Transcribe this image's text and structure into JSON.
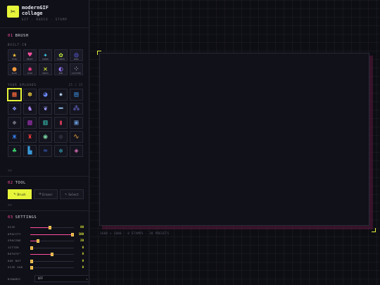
{
  "brand": {
    "logo_glyph": "✂",
    "name": "modernGIF",
    "sub": "collage",
    "nav": "GIF · RADIO · STAMP"
  },
  "brush": {
    "num": "01",
    "title": "BRUSH",
    "builtin_label": "BUILT-IN",
    "builtin": [
      {
        "icon": "star-icon",
        "glyph": "★",
        "color": "#f5c53a",
        "label": "STAR"
      },
      {
        "icon": "heart-icon",
        "glyph": "♥",
        "color": "#ff4fa0",
        "label": "HEART"
      },
      {
        "icon": "sparkle-icon",
        "glyph": "✦",
        "color": "#3ad9f5",
        "label": "SPARK"
      },
      {
        "icon": "flower-icon",
        "glyph": "✿",
        "color": "#c8f53a",
        "label": "FLOWER"
      },
      {
        "icon": "ring-icon",
        "glyph": "◎",
        "color": "#6a6aff",
        "label": "RING"
      },
      {
        "icon": "blob-icon",
        "glyph": "●",
        "color": "#f59a3a",
        "label": "BLOB"
      },
      {
        "icon": "glow-icon",
        "glyph": "✺",
        "color": "#ff3a8a",
        "label": "GLOW"
      },
      {
        "icon": "cross-icon",
        "glyph": "✕",
        "color": "#e6f53a",
        "label": "CROSS"
      },
      {
        "icon": "rainbow-orb-icon",
        "glyph": "◐",
        "color": "#9a7aff",
        "label": "ORB"
      },
      {
        "icon": "scatter-icon",
        "glyph": "⁘",
        "color": "#d0d0e0",
        "label": "SCATTER"
      }
    ],
    "uploads_label": "YOUR UPLOADS",
    "uploads_count": "25 / 25",
    "uploads": [
      {
        "icon": "rainbow-image-icon",
        "glyph": "▦",
        "color": "#ff6a3a"
      },
      {
        "icon": "flower-image-icon",
        "glyph": "✽",
        "color": "#e6c53a"
      },
      {
        "icon": "eyes-image-icon",
        "glyph": "◕",
        "color": "#6a8aff"
      },
      {
        "icon": "sparkle-image-icon",
        "glyph": "✷",
        "color": "#c0e0ff"
      },
      {
        "icon": "sky-image-icon",
        "glyph": "▤",
        "color": "#3a8ad9"
      },
      {
        "icon": "crystal-image-icon",
        "glyph": "❖",
        "color": "#8a9aff"
      },
      {
        "icon": "figure-image-icon",
        "glyph": "♞",
        "color": "#b08aff"
      },
      {
        "icon": "bird-image-icon",
        "glyph": "❦",
        "color": "#a0a0ff"
      },
      {
        "icon": "laser-image-icon",
        "glyph": "━",
        "color": "#9ad0ff"
      },
      {
        "icon": "stars-image-icon",
        "glyph": "⁂",
        "color": "#6a6ad0"
      },
      {
        "icon": "rock-image-icon",
        "glyph": "◆",
        "color": "#6a6a7a"
      },
      {
        "icon": "neon-image-icon",
        "glyph": "▧",
        "color": "#c03ad9"
      },
      {
        "icon": "rain-image-icon",
        "glyph": "▥",
        "color": "#3ad0c0"
      },
      {
        "icon": "drink-image-icon",
        "glyph": "▮",
        "color": "#d03a5a"
      },
      {
        "icon": "window-image-icon",
        "glyph": "▣",
        "color": "#6a9ad9"
      },
      {
        "icon": "butterfly-image-icon",
        "glyph": "ж",
        "color": "#3a8aff"
      },
      {
        "icon": "robot-image-icon",
        "glyph": "♜",
        "color": "#e63a3a"
      },
      {
        "icon": "disc-image-icon",
        "glyph": "◉",
        "color": "#7ad0a0"
      },
      {
        "icon": "planet-image-icon",
        "glyph": "●",
        "color": "#2a2a3a"
      },
      {
        "icon": "wave-image-icon",
        "glyph": "∿",
        "color": "#e6a23a"
      },
      {
        "icon": "cactus-image-icon",
        "glyph": "♣",
        "color": "#3ad06a"
      },
      {
        "icon": "city-image-icon",
        "glyph": "▙",
        "color": "#3a9ad9"
      },
      {
        "icon": "ocean-image-icon",
        "glyph": "≈",
        "color": "#3a6ad9"
      },
      {
        "icon": "feather-image-icon",
        "glyph": "✲",
        "color": "#3ac0d9"
      },
      {
        "icon": "gem-image-icon",
        "glyph": "◈",
        "color": "#d06ab0"
      }
    ],
    "collapse": ">>"
  },
  "tool": {
    "num": "02",
    "title": "TOOL",
    "items": [
      {
        "icon": "pencil-icon",
        "glyph": "✎",
        "label": "Brush",
        "active": true
      },
      {
        "icon": "eraser-icon",
        "glyph": "⌫",
        "label": "Eraser",
        "active": false
      },
      {
        "icon": "cursor-icon",
        "glyph": "↖",
        "label": "Select",
        "active": false
      }
    ],
    "collapse": ">>"
  },
  "settings": {
    "num": "03",
    "title": "SETTINGS",
    "rows": [
      {
        "label": "SIZE",
        "value": "80",
        "level": 0.45
      },
      {
        "label": "OPACITY",
        "value": "100",
        "level": 1.0
      },
      {
        "label": "SPACING",
        "value": "20",
        "level": 0.18
      },
      {
        "label": "JITTER",
        "value": "0",
        "level": 0.0
      },
      {
        "label": "ROTATE°",
        "value": "0",
        "level": 0.5
      },
      {
        "label": "HUE ROT",
        "value": "0",
        "level": 0.0
      },
      {
        "label": "SIZE VAR",
        "value": "0",
        "level": 0.0
      }
    ],
    "dynamic_label": "DYNAMIC",
    "dynamic_value": "OFF"
  },
  "canvas": {
    "info": "1600 × 1000 · 0 STAMPS · 30 PRESETS"
  }
}
